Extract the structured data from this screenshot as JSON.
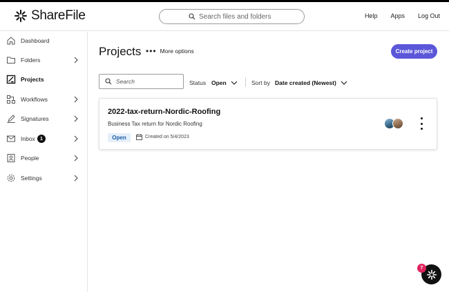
{
  "header": {
    "logo_text": "ShareFile",
    "search_placeholder": "Search files and folders",
    "links": [
      "Help",
      "Apps",
      "Log Out"
    ]
  },
  "sidebar": {
    "items": [
      {
        "label": "Dashboard",
        "icon": "home-icon",
        "chevron": false,
        "active": false
      },
      {
        "label": "Folders",
        "icon": "folder-icon",
        "chevron": true,
        "active": false
      },
      {
        "label": "Projects",
        "icon": "projects-icon",
        "chevron": false,
        "active": true
      },
      {
        "label": "Workflows",
        "icon": "workflow-icon",
        "chevron": true,
        "active": false
      },
      {
        "label": "Signatures",
        "icon": "pen-icon",
        "chevron": true,
        "active": false
      },
      {
        "label": "Inbox",
        "icon": "envelope-icon",
        "chevron": true,
        "active": false,
        "badge": "1"
      },
      {
        "label": "People",
        "icon": "contact-icon",
        "chevron": true,
        "active": false
      },
      {
        "label": "Settings",
        "icon": "gear-icon",
        "chevron": true,
        "active": false
      }
    ]
  },
  "main": {
    "title": "Projects",
    "more_options": "More options",
    "create_button": "Create project",
    "search_placeholder": "Search",
    "status_label": "Status",
    "status_value": "Open",
    "sort_label": "Sort by",
    "sort_value": "Date created (Newest)"
  },
  "project_card": {
    "title": "2022-tax-return-Nordic-Roofing",
    "subtitle": "Business Tax return for Nordic Roofing",
    "status": "Open",
    "created": "Created on 5/4/2023"
  },
  "help_fab": {
    "badge": "7"
  },
  "colors": {
    "accent": "#5b57d9",
    "status_pill_bg": "#e4effa",
    "status_pill_text": "#1a5ca6",
    "fab_badge": "#e0245e"
  }
}
